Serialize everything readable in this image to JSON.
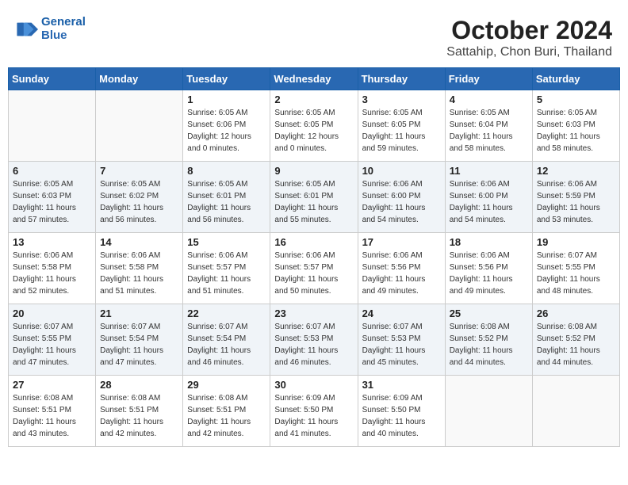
{
  "header": {
    "logo_line1": "General",
    "logo_line2": "Blue",
    "title": "October 2024",
    "subtitle": "Sattahip, Chon Buri, Thailand"
  },
  "weekdays": [
    "Sunday",
    "Monday",
    "Tuesday",
    "Wednesday",
    "Thursday",
    "Friday",
    "Saturday"
  ],
  "weeks": [
    [
      {
        "day": "",
        "info": ""
      },
      {
        "day": "",
        "info": ""
      },
      {
        "day": "1",
        "info": "Sunrise: 6:05 AM\nSunset: 6:06 PM\nDaylight: 12 hours\nand 0 minutes."
      },
      {
        "day": "2",
        "info": "Sunrise: 6:05 AM\nSunset: 6:05 PM\nDaylight: 12 hours\nand 0 minutes."
      },
      {
        "day": "3",
        "info": "Sunrise: 6:05 AM\nSunset: 6:05 PM\nDaylight: 11 hours\nand 59 minutes."
      },
      {
        "day": "4",
        "info": "Sunrise: 6:05 AM\nSunset: 6:04 PM\nDaylight: 11 hours\nand 58 minutes."
      },
      {
        "day": "5",
        "info": "Sunrise: 6:05 AM\nSunset: 6:03 PM\nDaylight: 11 hours\nand 58 minutes."
      }
    ],
    [
      {
        "day": "6",
        "info": "Sunrise: 6:05 AM\nSunset: 6:03 PM\nDaylight: 11 hours\nand 57 minutes."
      },
      {
        "day": "7",
        "info": "Sunrise: 6:05 AM\nSunset: 6:02 PM\nDaylight: 11 hours\nand 56 minutes."
      },
      {
        "day": "8",
        "info": "Sunrise: 6:05 AM\nSunset: 6:01 PM\nDaylight: 11 hours\nand 56 minutes."
      },
      {
        "day": "9",
        "info": "Sunrise: 6:05 AM\nSunset: 6:01 PM\nDaylight: 11 hours\nand 55 minutes."
      },
      {
        "day": "10",
        "info": "Sunrise: 6:06 AM\nSunset: 6:00 PM\nDaylight: 11 hours\nand 54 minutes."
      },
      {
        "day": "11",
        "info": "Sunrise: 6:06 AM\nSunset: 6:00 PM\nDaylight: 11 hours\nand 54 minutes."
      },
      {
        "day": "12",
        "info": "Sunrise: 6:06 AM\nSunset: 5:59 PM\nDaylight: 11 hours\nand 53 minutes."
      }
    ],
    [
      {
        "day": "13",
        "info": "Sunrise: 6:06 AM\nSunset: 5:58 PM\nDaylight: 11 hours\nand 52 minutes."
      },
      {
        "day": "14",
        "info": "Sunrise: 6:06 AM\nSunset: 5:58 PM\nDaylight: 11 hours\nand 51 minutes."
      },
      {
        "day": "15",
        "info": "Sunrise: 6:06 AM\nSunset: 5:57 PM\nDaylight: 11 hours\nand 51 minutes."
      },
      {
        "day": "16",
        "info": "Sunrise: 6:06 AM\nSunset: 5:57 PM\nDaylight: 11 hours\nand 50 minutes."
      },
      {
        "day": "17",
        "info": "Sunrise: 6:06 AM\nSunset: 5:56 PM\nDaylight: 11 hours\nand 49 minutes."
      },
      {
        "day": "18",
        "info": "Sunrise: 6:06 AM\nSunset: 5:56 PM\nDaylight: 11 hours\nand 49 minutes."
      },
      {
        "day": "19",
        "info": "Sunrise: 6:07 AM\nSunset: 5:55 PM\nDaylight: 11 hours\nand 48 minutes."
      }
    ],
    [
      {
        "day": "20",
        "info": "Sunrise: 6:07 AM\nSunset: 5:55 PM\nDaylight: 11 hours\nand 47 minutes."
      },
      {
        "day": "21",
        "info": "Sunrise: 6:07 AM\nSunset: 5:54 PM\nDaylight: 11 hours\nand 47 minutes."
      },
      {
        "day": "22",
        "info": "Sunrise: 6:07 AM\nSunset: 5:54 PM\nDaylight: 11 hours\nand 46 minutes."
      },
      {
        "day": "23",
        "info": "Sunrise: 6:07 AM\nSunset: 5:53 PM\nDaylight: 11 hours\nand 46 minutes."
      },
      {
        "day": "24",
        "info": "Sunrise: 6:07 AM\nSunset: 5:53 PM\nDaylight: 11 hours\nand 45 minutes."
      },
      {
        "day": "25",
        "info": "Sunrise: 6:08 AM\nSunset: 5:52 PM\nDaylight: 11 hours\nand 44 minutes."
      },
      {
        "day": "26",
        "info": "Sunrise: 6:08 AM\nSunset: 5:52 PM\nDaylight: 11 hours\nand 44 minutes."
      }
    ],
    [
      {
        "day": "27",
        "info": "Sunrise: 6:08 AM\nSunset: 5:51 PM\nDaylight: 11 hours\nand 43 minutes."
      },
      {
        "day": "28",
        "info": "Sunrise: 6:08 AM\nSunset: 5:51 PM\nDaylight: 11 hours\nand 42 minutes."
      },
      {
        "day": "29",
        "info": "Sunrise: 6:08 AM\nSunset: 5:51 PM\nDaylight: 11 hours\nand 42 minutes."
      },
      {
        "day": "30",
        "info": "Sunrise: 6:09 AM\nSunset: 5:50 PM\nDaylight: 11 hours\nand 41 minutes."
      },
      {
        "day": "31",
        "info": "Sunrise: 6:09 AM\nSunset: 5:50 PM\nDaylight: 11 hours\nand 40 minutes."
      },
      {
        "day": "",
        "info": ""
      },
      {
        "day": "",
        "info": ""
      }
    ]
  ]
}
